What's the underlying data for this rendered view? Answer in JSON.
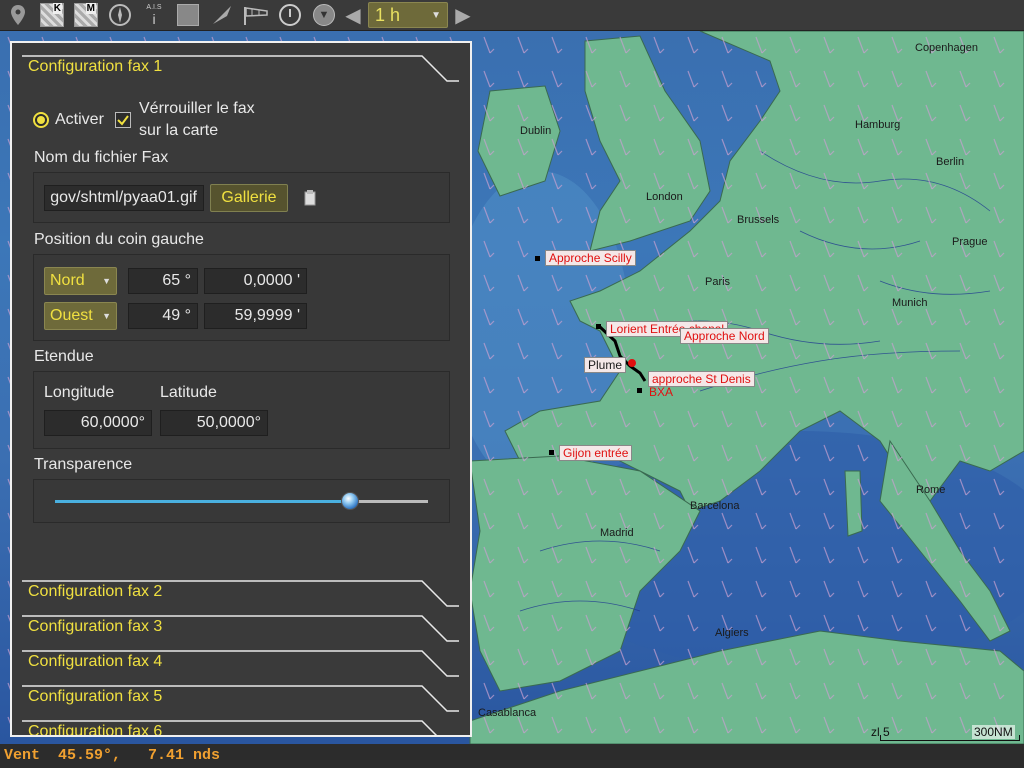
{
  "toolbar": {
    "icons": [
      "pin-icon",
      "k-layer-icon",
      "m-layer-icon",
      "compass-icon",
      "ais-icon",
      "square-icon",
      "route-icon",
      "windsock-icon",
      "clock-icon",
      "download-icon",
      "prev-icon",
      "next-icon"
    ],
    "k_label": "K",
    "m_label": "M",
    "ais_label": "A.I.S",
    "ais_glyph": "i",
    "time_value": "1 h"
  },
  "panel": {
    "section1": "Configuration fax 1",
    "activate_label": "Activer",
    "lock_label_1": "Vérrouiller le fax",
    "lock_label_2": "sur la carte",
    "filename_label": "Nom du fichier Fax",
    "filename_value": "gov/shtml/pyaa01.gif",
    "gallery_button": "Gallerie",
    "corner_label": "Position du coin gauche",
    "lat_hemisphere": "Nord",
    "lat_degrees": "65 °",
    "lat_minutes": "0,0000 '",
    "lon_hemisphere": "Ouest",
    "lon_degrees": "49 °",
    "lon_minutes": "59,9999 '",
    "extent_label": "Etendue",
    "longitude_label": "Longitude",
    "latitude_label": "Latitude",
    "longitude_value": "60,0000°",
    "latitude_value": "50,0000°",
    "transparency_label": "Transparence",
    "transparency_level": 0.79,
    "section2": "Configuration fax 2",
    "section3": "Configuration fax 3",
    "section4": "Configuration fax 4",
    "section5": "Configuration fax 5",
    "section6": "Configuration fax 6"
  },
  "map": {
    "cities": {
      "dublin": "Dublin",
      "london": "London",
      "hamburg": "Hamburg",
      "copenhagen": "Copenhagen",
      "berlin": "Berlin",
      "brussels": "Brussels",
      "prague": "Prague",
      "paris": "Paris",
      "munich": "Munich",
      "madrid": "Madrid",
      "barcelona": "Barcelona",
      "rome": "Rome",
      "casablanca": "Casablanca",
      "algiers": "Algiers"
    },
    "waypoints": {
      "scilly": "Approche Scilly",
      "lorient": "Lorient Entrée chenal",
      "nord": "Approche Nord",
      "plume": "Plume",
      "stdenis": "approche St Denis",
      "bxa": "BXA",
      "gijon": "Gijon entrée"
    },
    "zoom_label": "zl 5",
    "scale_label": "300NM"
  },
  "status": {
    "text": "Vent  45.59°,   7.41 nds"
  },
  "colors": {
    "accent_yellow": "#f0e040",
    "status_orange": "#f0a030",
    "waypoint_red": "#e01010"
  }
}
